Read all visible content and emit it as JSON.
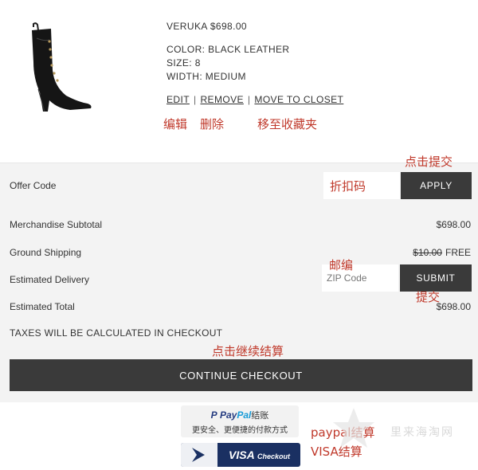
{
  "product": {
    "name_price": "VERUKA $698.00",
    "color": "COLOR: BLACK LEATHER",
    "size": "SIZE: 8",
    "width": "WIDTH: MEDIUM",
    "links": {
      "edit": "EDIT",
      "remove": "REMOVE",
      "move": "MOVE TO CLOSET",
      "separator": "|"
    }
  },
  "annotations": {
    "edit": "编辑",
    "remove": "删除",
    "move": "移至收藏夹",
    "click_submit": "点击提交",
    "discount_code": "折扣码",
    "zip": "邮编",
    "submit": "提交",
    "continue": "点击继续结算",
    "paypal": "paypal结算",
    "visa": "VISA结算"
  },
  "summary": {
    "offer_code_label": "Offer Code",
    "apply_label": "APPLY",
    "merch_subtotal_label": "Merchandise Subtotal",
    "merch_subtotal_value": "$698.00",
    "shipping_label": "Ground Shipping",
    "shipping_old": "$10.00",
    "shipping_value": "FREE",
    "delivery_label": "Estimated Delivery",
    "zip_placeholder": "ZIP Code",
    "submit_label": "SUBMIT",
    "total_label": "Estimated Total",
    "total_value": "$698.00",
    "taxes_note": "TAXES WILL BE CALCULATED IN CHECKOUT",
    "continue_label": "CONTINUE CHECKOUT"
  },
  "paypal": {
    "logo_part1": "Pay",
    "logo_part2": "Pal",
    "logo_suffix": "结账",
    "tagline": "更安全、更便捷的付款方式"
  },
  "visa": {
    "brand": "VISA",
    "suffix": "Checkout"
  },
  "watermark": "里来海淘网",
  "colors": {
    "button_dark": "#3a3a3a",
    "panel_bg": "#f3f3f3",
    "annotation_red": "#c0392b",
    "visa_blue": "#1a3062",
    "paypal_dark_blue": "#253b80",
    "paypal_light_blue": "#179bd7"
  }
}
